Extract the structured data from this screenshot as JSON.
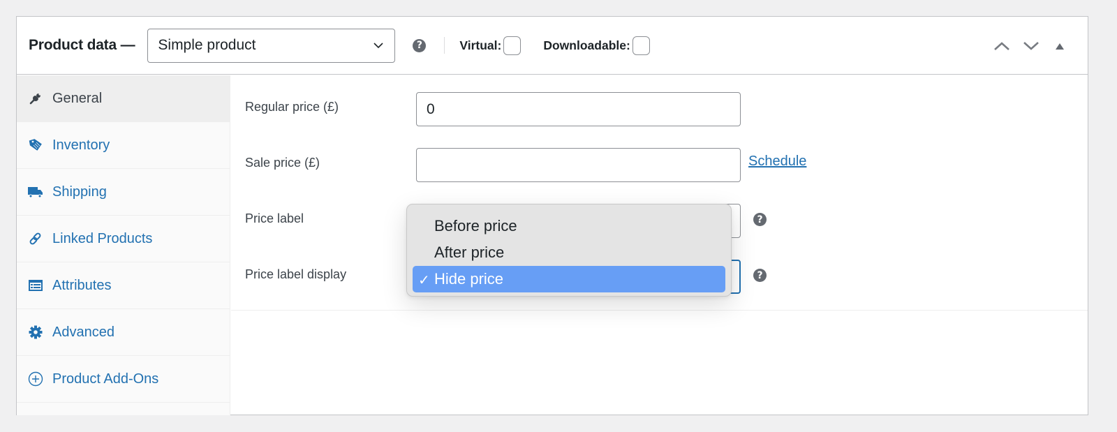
{
  "header": {
    "title": "Product data —",
    "product_type": "Simple product",
    "virtual_label": "Virtual:",
    "virtual_checked": false,
    "downloadable_label": "Downloadable:",
    "downloadable_checked": false,
    "help_icon": "question-circle-icon",
    "controls": [
      "move-up-icon",
      "move-down-icon",
      "collapse-toggle-icon"
    ]
  },
  "sidebar": {
    "items": [
      {
        "label": "General",
        "icon": "wrench-icon",
        "active": true
      },
      {
        "label": "Inventory",
        "icon": "tag-icon",
        "active": false
      },
      {
        "label": "Shipping",
        "icon": "truck-icon",
        "active": false
      },
      {
        "label": "Linked Products",
        "icon": "link-icon",
        "active": false
      },
      {
        "label": "Attributes",
        "icon": "list-card-icon",
        "active": false
      },
      {
        "label": "Advanced",
        "icon": "gear-icon",
        "active": false
      },
      {
        "label": "Product Add-Ons",
        "icon": "plus-circle-icon",
        "active": false
      }
    ]
  },
  "general": {
    "regular_price_label": "Regular price (£)",
    "regular_price_value": "0",
    "sale_price_label": "Sale price (£)",
    "sale_price_value": "",
    "schedule_link": "Schedule",
    "price_label_label": "Price label",
    "price_label_value": "",
    "price_label_display_label": "Price label display",
    "price_label_display_value": "Hide price"
  },
  "dropdown": {
    "options": [
      {
        "label": "Before price",
        "selected": false
      },
      {
        "label": "After price",
        "selected": false
      },
      {
        "label": "Hide price",
        "selected": true
      }
    ],
    "check_glyph": "✓"
  },
  "colors": {
    "link": "#2271b1",
    "selected_option": "#679ef5",
    "active_tab_bg": "#eeeeee"
  }
}
